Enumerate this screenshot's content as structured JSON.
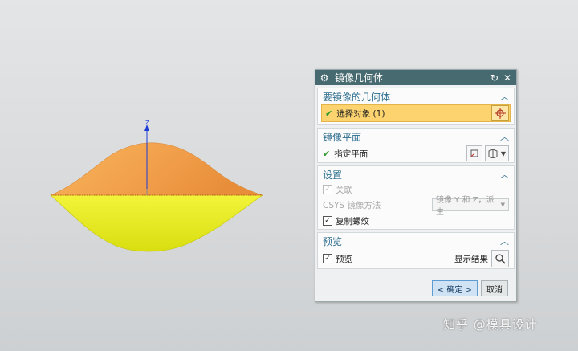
{
  "viewport": {
    "axis_label": "Z",
    "colors": {
      "top_surface": "#f2a04c",
      "bottom_surface": "#e8ec16",
      "axis": "#1f3bd6"
    }
  },
  "dialog": {
    "title": "镜像几何体",
    "groups": {
      "geometry": {
        "title": "要镜像的几何体",
        "select_label": "选择对象 (1)"
      },
      "plane": {
        "title": "镜像平面",
        "specify_label": "指定平面"
      },
      "settings": {
        "title": "设置",
        "associative_label": "关联",
        "csys_label": "CSYS 镜像方法",
        "csys_value": "镜像 Y 和 Z，派生",
        "copy_threads_label": "复制螺纹"
      },
      "preview": {
        "title": "预览",
        "preview_label": "预览",
        "show_result_label": "显示结果"
      }
    },
    "ok_label": "< 确定 >",
    "cancel_label": "取消"
  },
  "watermark": "知乎 @模具设计"
}
